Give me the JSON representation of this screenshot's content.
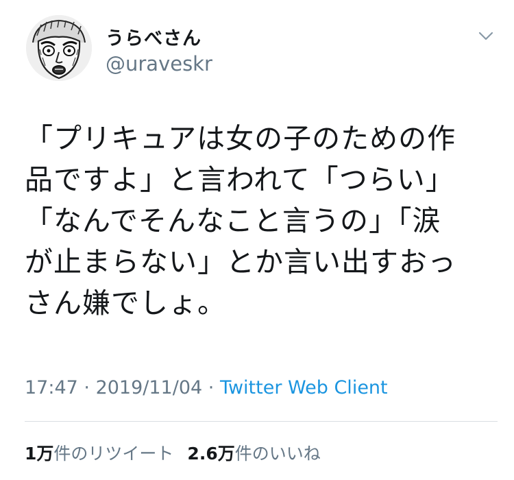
{
  "user": {
    "display_name": "うらべさん",
    "handle": "@uraveskr",
    "avatar_icon": "avatar-illustration-icon"
  },
  "menu": {
    "icon": "chevron-down-icon"
  },
  "tweet": {
    "lines": [
      "「プリキュアは女の子のための作",
      "品ですよ」と言われて「つらい」",
      "「なんでそんなこと言うの」「涙",
      "が止まらない」とか言い出すおっ",
      "さん嫌でしょ。"
    ]
  },
  "meta": {
    "time": "17:47",
    "separator1": " · ",
    "date": "2019/11/04",
    "separator2": " · ",
    "client": "Twitter Web Client"
  },
  "stats": {
    "retweets_count": "1万",
    "retweets_label": "件のリツイート",
    "likes_count": "2.6万",
    "likes_label": "件のいいね"
  },
  "colors": {
    "text": "#14171a",
    "secondary": "#657786",
    "link": "#1b95e0",
    "divider": "#d9dee2"
  }
}
